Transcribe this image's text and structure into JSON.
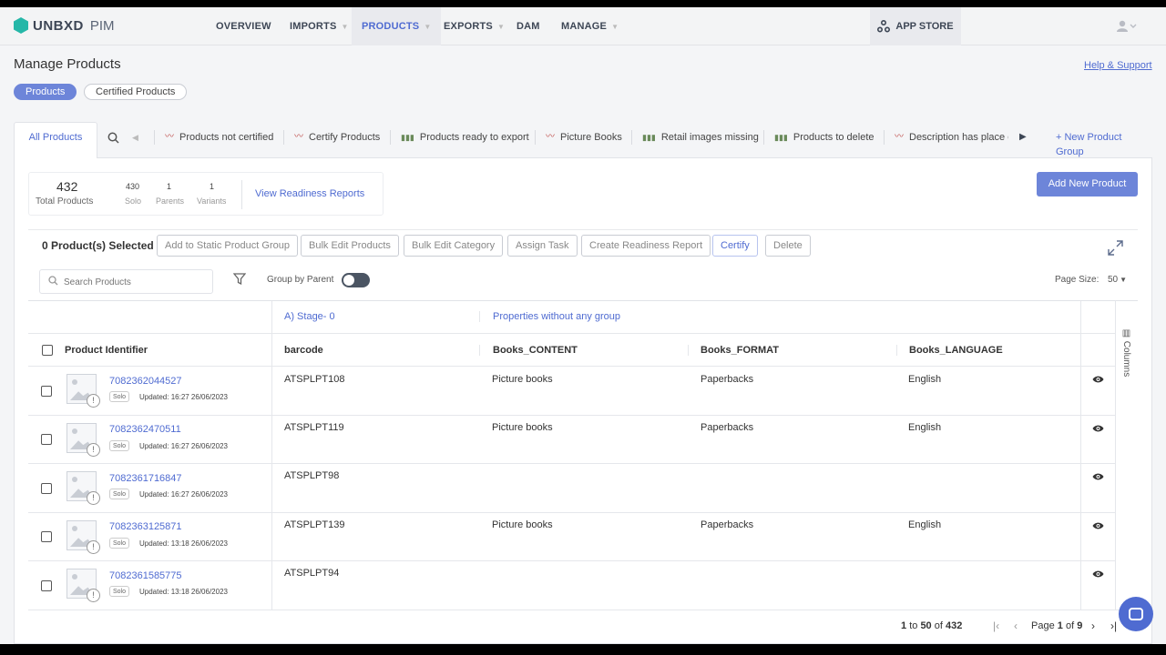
{
  "app": {
    "brand": "UNBXD",
    "product": "PIM"
  },
  "nav": {
    "overview": "OVERVIEW",
    "imports": "IMPORTS",
    "products": "PRODUCTS",
    "exports": "EXPORTS",
    "dam": "DAM",
    "manage": "MANAGE",
    "app_store": "APP STORE"
  },
  "header": {
    "title": "Manage Products",
    "help": "Help & Support"
  },
  "pills": {
    "products": "Products",
    "certified": "Certified Products"
  },
  "tabs": {
    "all": "All Products",
    "groups": [
      {
        "label": "Products not certified",
        "icon": "activity-icon"
      },
      {
        "label": "Certify Products",
        "icon": "activity-icon"
      },
      {
        "label": "Products ready to export",
        "icon": "bar-chart-icon"
      },
      {
        "label": "Picture Books",
        "icon": "activity-icon"
      },
      {
        "label": "Retail images missing",
        "icon": "bar-chart-icon"
      },
      {
        "label": "Products to delete",
        "icon": "bar-chart-icon"
      },
      {
        "label": "Description has place o",
        "icon": "activity-icon"
      }
    ],
    "new_group": "+ New Product Group"
  },
  "stats": {
    "total": "432",
    "total_label": "Total Products",
    "solo": "430",
    "solo_label": "Solo",
    "parents": "1",
    "parents_label": "Parents",
    "variants": "1",
    "variants_label": "Variants",
    "readiness": "View Readiness Reports"
  },
  "add_new": "Add New Product",
  "actions": {
    "selected": "0 Product(s) Selected",
    "add_static": "Add to Static Product Group",
    "bulk_edit_products": "Bulk Edit Products",
    "bulk_edit_category": "Bulk Edit Category",
    "assign_task": "Assign Task",
    "create_report": "Create Readiness Report",
    "certify": "Certify",
    "delete": "Delete"
  },
  "filters": {
    "search_placeholder": "Search Products",
    "group_by_parent": "Group by Parent",
    "page_size_label": "Page Size:",
    "page_size": "50"
  },
  "grid": {
    "group_stage": "A) Stage- 0",
    "group_props": "Properties without any group",
    "col_identifier": "Product Identifier",
    "col_barcode": "barcode",
    "col_content": "Books_CONTENT",
    "col_format": "Books_FORMAT",
    "col_language": "Books_LANGUAGE",
    "columns_label": "Columns",
    "rows": [
      {
        "id": "7082362044527",
        "type": "Solo",
        "updated": "Updated: 16:27 26/06/2023",
        "barcode": "ATSPLPT108",
        "content": "Picture books",
        "format": "Paperbacks",
        "language": "English"
      },
      {
        "id": "7082362470511",
        "type": "Solo",
        "updated": "Updated: 16:27 26/06/2023",
        "barcode": "ATSPLPT119",
        "content": "Picture books",
        "format": "Paperbacks",
        "language": "English"
      },
      {
        "id": "7082361716847",
        "type": "Solo",
        "updated": "Updated: 16:27 26/06/2023",
        "barcode": "ATSPLPT98",
        "content": "",
        "format": "",
        "language": ""
      },
      {
        "id": "7082363125871",
        "type": "Solo",
        "updated": "Updated: 13:18 26/06/2023",
        "barcode": "ATSPLPT139",
        "content": "Picture books",
        "format": "Paperbacks",
        "language": "English"
      },
      {
        "id": "7082361585775",
        "type": "Solo",
        "updated": "Updated: 13:18 26/06/2023",
        "barcode": "ATSPLPT94",
        "content": "",
        "format": "",
        "language": ""
      }
    ]
  },
  "pager": {
    "from": "1",
    "to_word": "to",
    "to": "50",
    "of_word": "of",
    "total": "432",
    "page_word": "Page",
    "page": "1",
    "page_total": "9"
  },
  "colors": {
    "accent": "#4f6bd1",
    "button": "#6d85d9",
    "logo": "#25b7a8"
  }
}
